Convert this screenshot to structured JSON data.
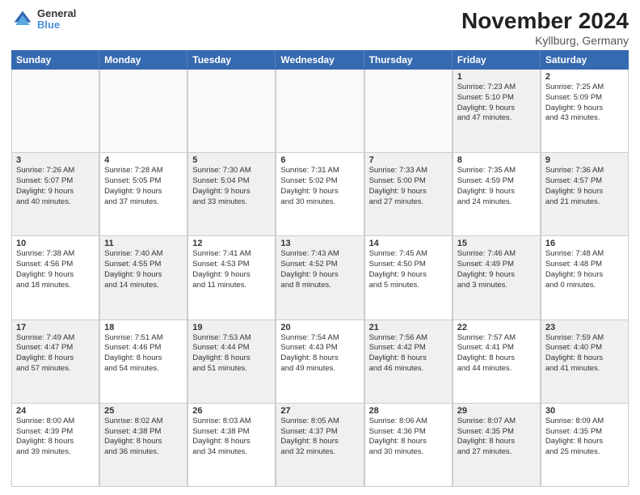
{
  "logo": {
    "line1": "General",
    "line2": "Blue"
  },
  "header": {
    "month": "November 2024",
    "location": "Kyllburg, Germany"
  },
  "weekdays": [
    "Sunday",
    "Monday",
    "Tuesday",
    "Wednesday",
    "Thursday",
    "Friday",
    "Saturday"
  ],
  "rows": [
    [
      {
        "day": "",
        "info": "",
        "empty": true
      },
      {
        "day": "",
        "info": "",
        "empty": true
      },
      {
        "day": "",
        "info": "",
        "empty": true
      },
      {
        "day": "",
        "info": "",
        "empty": true
      },
      {
        "day": "",
        "info": "",
        "empty": true
      },
      {
        "day": "1",
        "info": "Sunrise: 7:23 AM\nSunset: 5:10 PM\nDaylight: 9 hours\nand 47 minutes.",
        "shaded": true
      },
      {
        "day": "2",
        "info": "Sunrise: 7:25 AM\nSunset: 5:09 PM\nDaylight: 9 hours\nand 43 minutes.",
        "shaded": false
      }
    ],
    [
      {
        "day": "3",
        "info": "Sunrise: 7:26 AM\nSunset: 5:07 PM\nDaylight: 9 hours\nand 40 minutes.",
        "shaded": true
      },
      {
        "day": "4",
        "info": "Sunrise: 7:28 AM\nSunset: 5:05 PM\nDaylight: 9 hours\nand 37 minutes.",
        "shaded": false
      },
      {
        "day": "5",
        "info": "Sunrise: 7:30 AM\nSunset: 5:04 PM\nDaylight: 9 hours\nand 33 minutes.",
        "shaded": true
      },
      {
        "day": "6",
        "info": "Sunrise: 7:31 AM\nSunset: 5:02 PM\nDaylight: 9 hours\nand 30 minutes.",
        "shaded": false
      },
      {
        "day": "7",
        "info": "Sunrise: 7:33 AM\nSunset: 5:00 PM\nDaylight: 9 hours\nand 27 minutes.",
        "shaded": true
      },
      {
        "day": "8",
        "info": "Sunrise: 7:35 AM\nSunset: 4:59 PM\nDaylight: 9 hours\nand 24 minutes.",
        "shaded": false
      },
      {
        "day": "9",
        "info": "Sunrise: 7:36 AM\nSunset: 4:57 PM\nDaylight: 9 hours\nand 21 minutes.",
        "shaded": true
      }
    ],
    [
      {
        "day": "10",
        "info": "Sunrise: 7:38 AM\nSunset: 4:56 PM\nDaylight: 9 hours\nand 18 minutes.",
        "shaded": false
      },
      {
        "day": "11",
        "info": "Sunrise: 7:40 AM\nSunset: 4:55 PM\nDaylight: 9 hours\nand 14 minutes.",
        "shaded": true
      },
      {
        "day": "12",
        "info": "Sunrise: 7:41 AM\nSunset: 4:53 PM\nDaylight: 9 hours\nand 11 minutes.",
        "shaded": false
      },
      {
        "day": "13",
        "info": "Sunrise: 7:43 AM\nSunset: 4:52 PM\nDaylight: 9 hours\nand 8 minutes.",
        "shaded": true
      },
      {
        "day": "14",
        "info": "Sunrise: 7:45 AM\nSunset: 4:50 PM\nDaylight: 9 hours\nand 5 minutes.",
        "shaded": false
      },
      {
        "day": "15",
        "info": "Sunrise: 7:46 AM\nSunset: 4:49 PM\nDaylight: 9 hours\nand 3 minutes.",
        "shaded": true
      },
      {
        "day": "16",
        "info": "Sunrise: 7:48 AM\nSunset: 4:48 PM\nDaylight: 9 hours\nand 0 minutes.",
        "shaded": false
      }
    ],
    [
      {
        "day": "17",
        "info": "Sunrise: 7:49 AM\nSunset: 4:47 PM\nDaylight: 8 hours\nand 57 minutes.",
        "shaded": true
      },
      {
        "day": "18",
        "info": "Sunrise: 7:51 AM\nSunset: 4:46 PM\nDaylight: 8 hours\nand 54 minutes.",
        "shaded": false
      },
      {
        "day": "19",
        "info": "Sunrise: 7:53 AM\nSunset: 4:44 PM\nDaylight: 8 hours\nand 51 minutes.",
        "shaded": true
      },
      {
        "day": "20",
        "info": "Sunrise: 7:54 AM\nSunset: 4:43 PM\nDaylight: 8 hours\nand 49 minutes.",
        "shaded": false
      },
      {
        "day": "21",
        "info": "Sunrise: 7:56 AM\nSunset: 4:42 PM\nDaylight: 8 hours\nand 46 minutes.",
        "shaded": true
      },
      {
        "day": "22",
        "info": "Sunrise: 7:57 AM\nSunset: 4:41 PM\nDaylight: 8 hours\nand 44 minutes.",
        "shaded": false
      },
      {
        "day": "23",
        "info": "Sunrise: 7:59 AM\nSunset: 4:40 PM\nDaylight: 8 hours\nand 41 minutes.",
        "shaded": true
      }
    ],
    [
      {
        "day": "24",
        "info": "Sunrise: 8:00 AM\nSunset: 4:39 PM\nDaylight: 8 hours\nand 39 minutes.",
        "shaded": false
      },
      {
        "day": "25",
        "info": "Sunrise: 8:02 AM\nSunset: 4:38 PM\nDaylight: 8 hours\nand 36 minutes.",
        "shaded": true
      },
      {
        "day": "26",
        "info": "Sunrise: 8:03 AM\nSunset: 4:38 PM\nDaylight: 8 hours\nand 34 minutes.",
        "shaded": false
      },
      {
        "day": "27",
        "info": "Sunrise: 8:05 AM\nSunset: 4:37 PM\nDaylight: 8 hours\nand 32 minutes.",
        "shaded": true
      },
      {
        "day": "28",
        "info": "Sunrise: 8:06 AM\nSunset: 4:36 PM\nDaylight: 8 hours\nand 30 minutes.",
        "shaded": false
      },
      {
        "day": "29",
        "info": "Sunrise: 8:07 AM\nSunset: 4:35 PM\nDaylight: 8 hours\nand 27 minutes.",
        "shaded": true
      },
      {
        "day": "30",
        "info": "Sunrise: 8:09 AM\nSunset: 4:35 PM\nDaylight: 8 hours\nand 25 minutes.",
        "shaded": false
      }
    ]
  ]
}
